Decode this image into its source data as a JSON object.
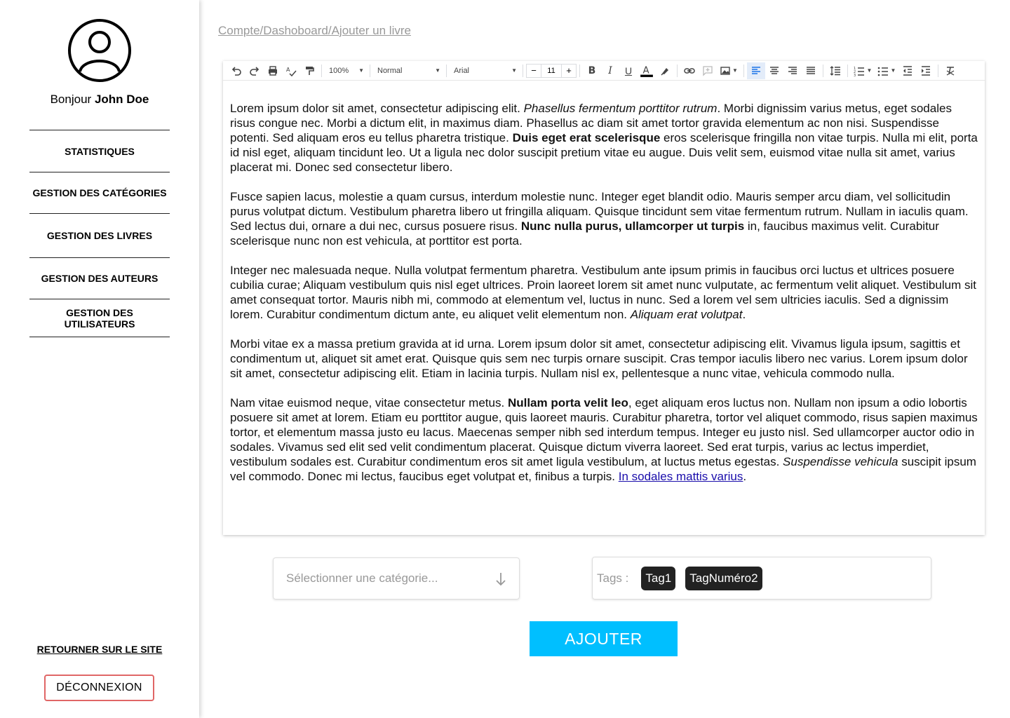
{
  "sidebar": {
    "greeting_prefix": "Bonjour",
    "user_name": "John Doe",
    "nav": [
      {
        "label": "STATISTIQUES"
      },
      {
        "label": "GESTION DES CATÉGORIES"
      },
      {
        "label": "GESTION DES LIVRES"
      },
      {
        "label": "GESTION DES AUTEURS"
      },
      {
        "label": "GESTION DES UTILISATEURS"
      }
    ],
    "back_link": "RETOURNER SUR LE SITE",
    "logout": "DÉCONNEXION"
  },
  "breadcrumb": "Compte/Dashoboard/Ajouter un livre",
  "toolbar": {
    "zoom": "100%",
    "style": "Normal",
    "font": "Arial",
    "font_size": "11"
  },
  "content": {
    "p1": {
      "a": "Lorem ipsum dolor sit amet, consectetur adipiscing elit. ",
      "b_italic": "Phasellus fermentum porttitor rutrum",
      "c": ". Morbi dignissim varius metus, eget sodales risus congue nec. Morbi a dictum elit, in maximus diam. Phasellus ac diam sit amet tortor gravida elementum ac non nisi. Suspendisse potenti. Sed aliquam eros eu tellus pharetra tristique. ",
      "d_bold": "Duis eget erat scelerisque",
      "e": " eros scelerisque fringilla non vitae turpis. Nulla mi elit, porta id nisl eget, aliquam tincidunt leo. Ut a ligula nec dolor suscipit pretium vitae eu augue. Duis velit sem, euismod vitae nulla sit amet, varius placerat mi. Donec sed consectetur libero."
    },
    "p2": {
      "a": "Fusce sapien lacus, molestie a quam cursus, interdum molestie nunc. Integer eget blandit odio. Mauris semper arcu diam, vel sollicitudin purus volutpat dictum. Vestibulum pharetra libero ut fringilla aliquam. Quisque tincidunt sem vitae fermentum rutrum. Nullam in iaculis quam. Sed lectus dui, ornare a dui nec, cursus posuere risus. ",
      "b_bold": "Nunc nulla purus, ullamcorper ut turpis",
      "c": " in, faucibus maximus velit. Curabitur scelerisque nunc non est vehicula, at porttitor est porta."
    },
    "p3": {
      "a": "Integer nec malesuada neque. Nulla volutpat fermentum pharetra. Vestibulum ante ipsum primis in faucibus orci luctus et ultrices posuere cubilia curae; Aliquam vestibulum quis nisl eget ultrices. Proin laoreet lorem sit amet nunc vulputate, ac fermentum velit aliquet. Vestibulum sit amet consequat tortor. Mauris nibh mi, commodo at elementum vel, luctus in nunc. Sed a lorem vel sem ultricies iaculis. Sed a dignissim lorem. Curabitur condimentum dictum ante, eu aliquet velit elementum non. ",
      "b_italic": "Aliquam erat volutpat",
      "c": "."
    },
    "p4": {
      "a": "Morbi vitae ex a massa pretium gravida at id urna. Lorem ipsum dolor sit amet, consectetur adipiscing elit. Vivamus ligula ipsum, sagittis et condimentum ut, aliquet sit amet erat. Quisque quis sem nec turpis ornare suscipit. Cras tempor iaculis libero nec varius. Lorem ipsum dolor sit amet, consectetur adipiscing elit. Etiam in lacinia turpis. Nullam nisl ex, pellentesque a nunc vitae, vehicula commodo nulla."
    },
    "p5": {
      "a": "Nam vitae euismod neque, vitae consectetur metus. ",
      "b_bold": "Nullam porta velit leo",
      "c": ", eget aliquam eros luctus non. Nullam non ipsum a odio lobortis posuere sit amet at lorem. Etiam eu porttitor augue, quis laoreet mauris. Curabitur pharetra, tortor vel aliquet commodo, risus sapien maximus tortor, et elementum massa justo eu lacus. Maecenas semper nibh sed interdum tempus. Integer eu justo nisl. Sed ullamcorper auctor odio in sodales. Vivamus sed elit sed velit condimentum placerat. Quisque dictum viverra laoreet. Sed erat turpis, varius ac lectus imperdiet, vestibulum sodales est. Curabitur condimentum eros sit amet ligula vestibulum, at luctus metus egestas. ",
      "d_italic": "Suspendisse vehicula",
      "e": " suscipit ipsum vel commodo. Donec mi lectus, faucibus eget volutpat et, finibus a turpis. ",
      "f_link": "In sodales mattis varius",
      "g": "."
    }
  },
  "category_select": {
    "placeholder": "Sélectionner une catégorie..."
  },
  "tags": {
    "label": "Tags :",
    "items": [
      "Tag1",
      "TagNuméro2"
    ]
  },
  "add_button": "AJOUTER",
  "colors": {
    "accent": "#00bfff",
    "logout_border": "#e06666",
    "tag_bg": "#222222"
  }
}
